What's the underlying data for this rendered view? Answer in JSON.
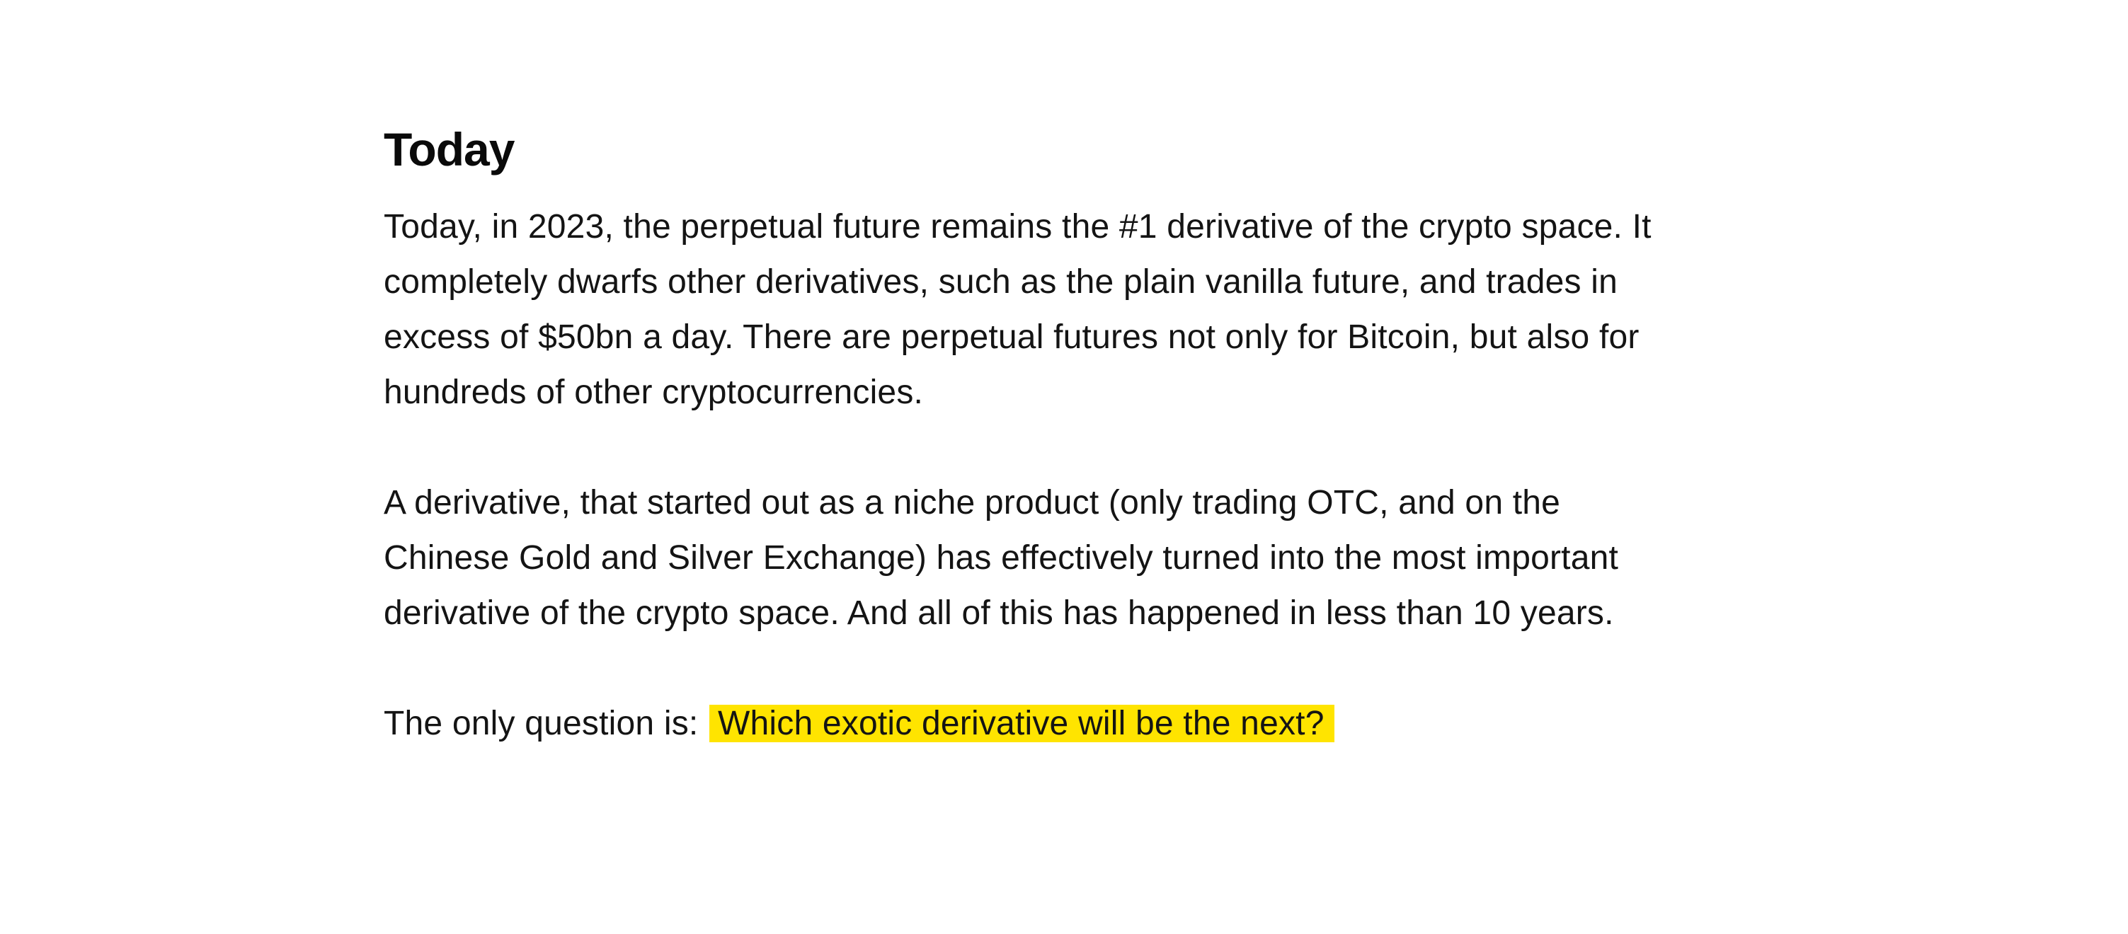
{
  "section": {
    "heading": "Today",
    "paragraph1": [
      "Today, in 2023, the perpetual future remains the #1 derivative of the crypto space. It",
      "completely dwarfs other derivatives, such as the plain vanilla future, and trades in",
      "excess of $50bn a day. There are perpetual futures not only for Bitcoin, but also for",
      "hundreds of other cryptocurrencies."
    ],
    "paragraph2": [
      "A derivative, that started out as a niche product (only trading OTC, and on the",
      "Chinese Gold and Silver Exchange) has effectively turned into the most important",
      "derivative of the crypto space. And all of this has happened in less than 10 years."
    ],
    "closing": {
      "lead": "The only question is:",
      "highlight": "Which exotic derivative will be the next?"
    }
  },
  "colors": {
    "highlight": "#ffe400",
    "text": "#141414",
    "background": "#ffffff"
  }
}
